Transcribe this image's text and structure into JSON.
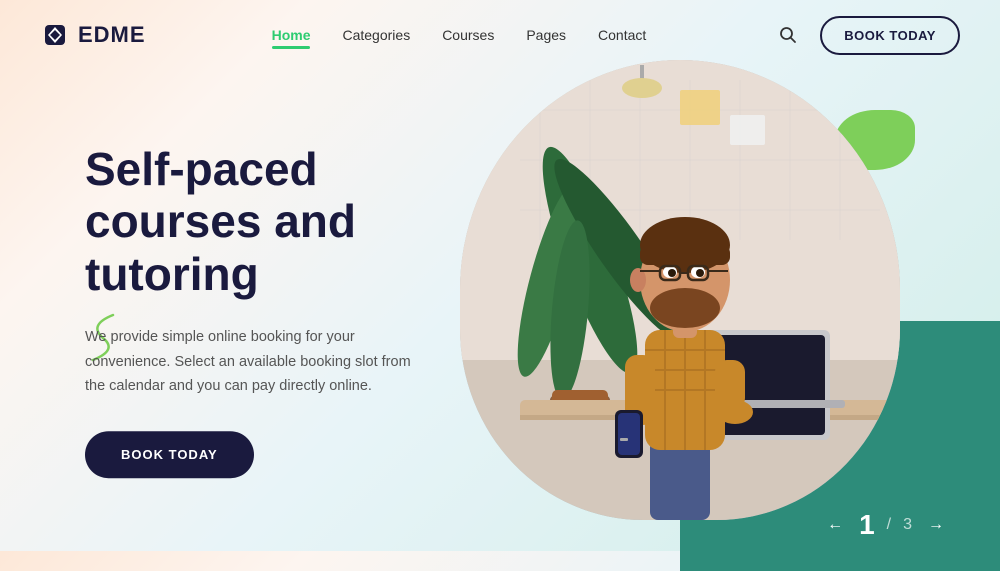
{
  "header": {
    "logo_text": "EDME",
    "nav": {
      "items": [
        {
          "label": "Home",
          "active": true
        },
        {
          "label": "Categories",
          "active": false
        },
        {
          "label": "Courses",
          "active": false
        },
        {
          "label": "Pages",
          "active": false
        },
        {
          "label": "Contact",
          "active": false
        }
      ],
      "book_today_label": "BOOK TODAY"
    }
  },
  "hero": {
    "title": "Self-paced courses and tutoring",
    "subtitle": "We provide simple online booking for your convenience. Select an available booking slot from the calendar and you can pay directly online.",
    "book_today_label": "BOOK TODAY",
    "pagination": {
      "current": "1",
      "separator": "/",
      "total": "3"
    }
  },
  "colors": {
    "dark_navy": "#1a1a3e",
    "green_accent": "#2ecc71",
    "teal": "#2d8c7a",
    "green_blob": "#7ecf5a"
  },
  "icons": {
    "logo": "diamond",
    "search": "search",
    "arrow_left": "←",
    "arrow_right": "→"
  }
}
